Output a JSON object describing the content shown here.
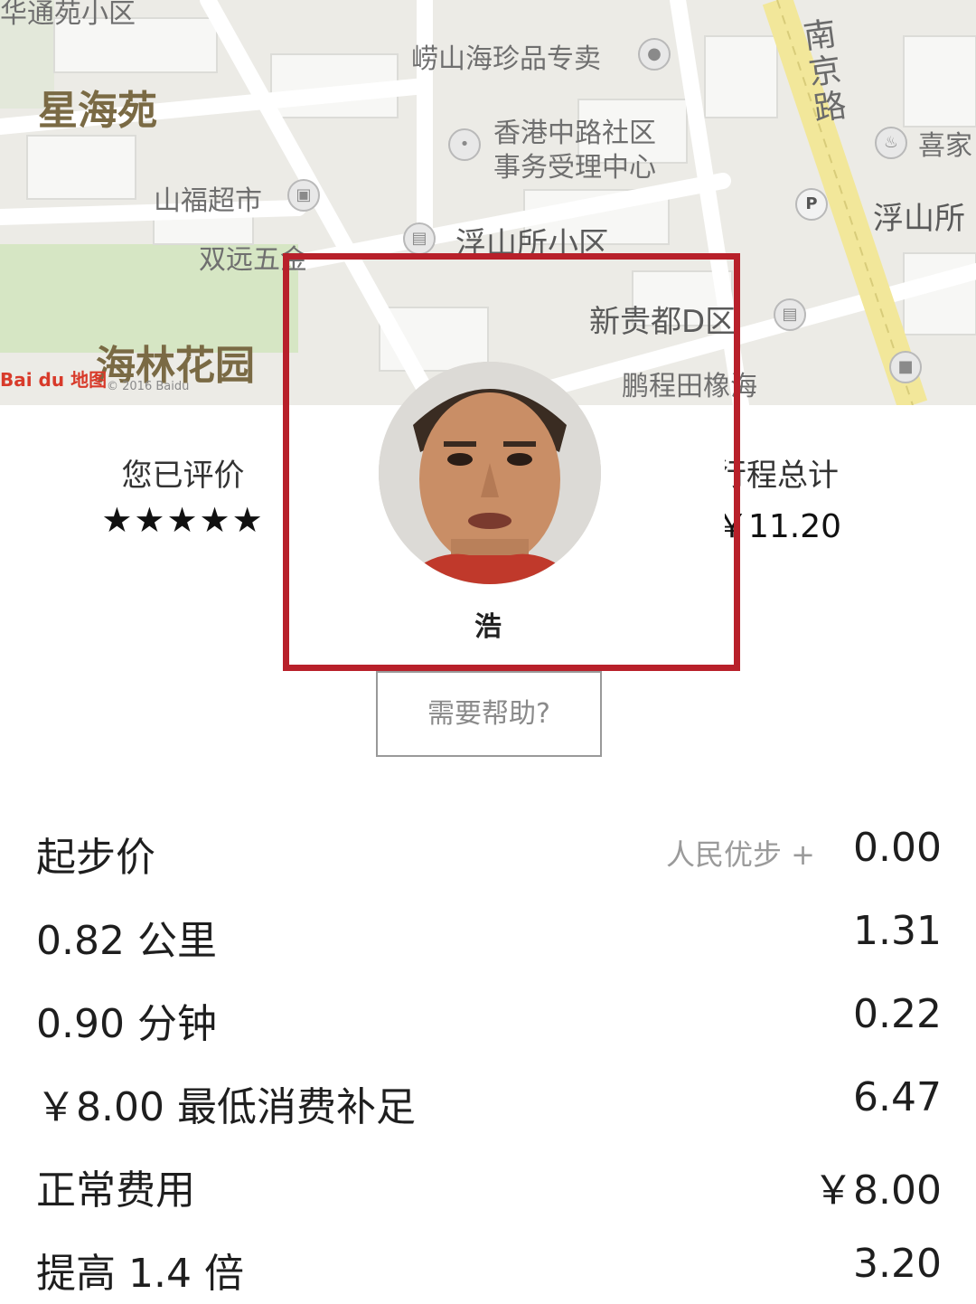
{
  "map": {
    "labels": {
      "top_left_partial": "华通苑小区",
      "xinghaiyuan": "星海苑",
      "laoshan_shop": "崂山海珍品专卖",
      "community_center_line1": "香港中路社区",
      "community_center_line2": "事务受理中心",
      "nanjing_road": "南京路",
      "xijia_partial": "喜家",
      "shanfu_market": "山福超市",
      "fushansuo_community": "浮山所小区",
      "fushansuo_partial": "浮山所",
      "shuangyuan_partial": "双远五金",
      "xinguidu": "新贵都D区",
      "hailin_garden": "海林花园",
      "pengcheng_partial": "鹏程田橡海"
    },
    "logo": "Bai du 地图",
    "copyright": "© 2016 Baidu"
  },
  "summary": {
    "rating_caption": "您已评价",
    "rating_stars": "★★★★★",
    "trip_caption": "行程总计",
    "trip_total": "￥11.20"
  },
  "driver": {
    "name": "浩",
    "help_button": "需要帮助?"
  },
  "fare_rows": [
    {
      "label": "起步价",
      "promo": "人民优步 +",
      "amount": "0.00"
    },
    {
      "label": "0.82 公里",
      "amount": "1.31"
    },
    {
      "label": "0.90 分钟",
      "amount": "0.22"
    },
    {
      "label": "￥8.00 最低消费补足",
      "amount": "6.47"
    },
    {
      "label": "正常费用",
      "amount": "￥8.00"
    },
    {
      "label": "提高 1.4 倍",
      "amount": "3.20"
    }
  ],
  "colors": {
    "highlight_border": "#b8202a",
    "map_background": "#ecebe6",
    "road_yellow": "#f2e79a"
  }
}
